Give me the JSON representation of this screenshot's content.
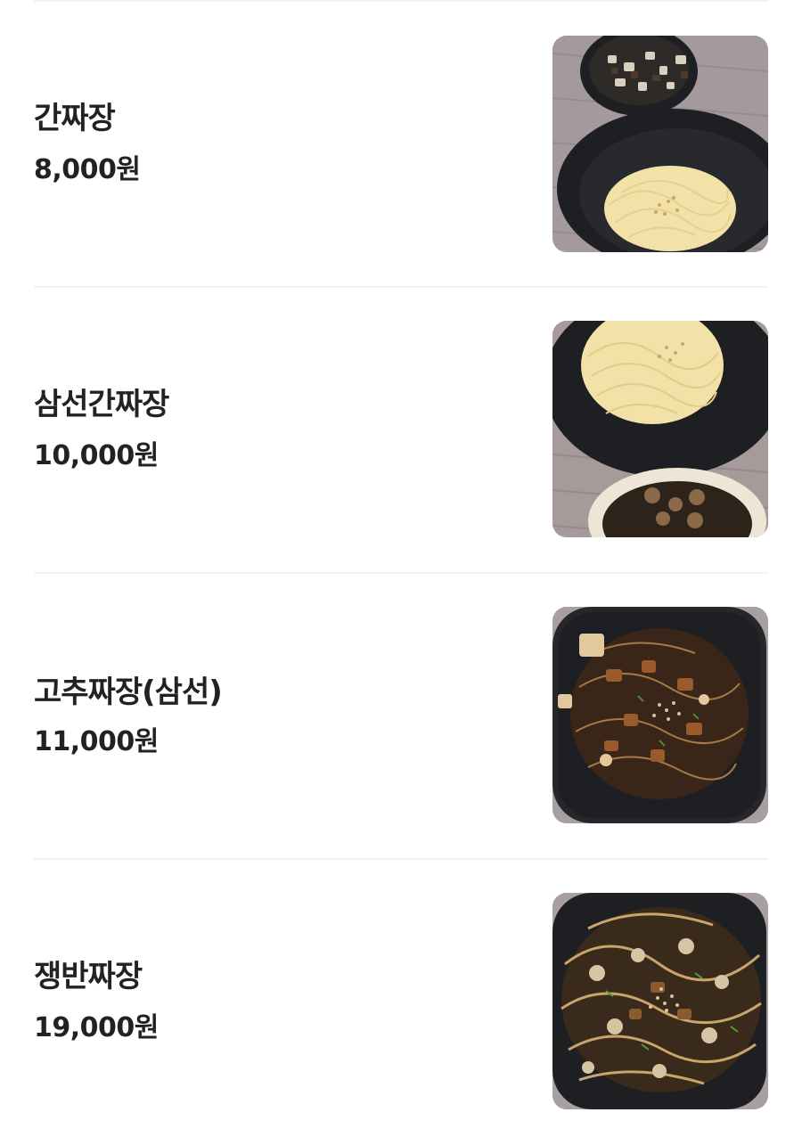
{
  "menu": {
    "items": [
      {
        "name": "간짜장",
        "price": "8,000원",
        "photo": "ganjjajang-photo"
      },
      {
        "name": "삼선간짜장",
        "price": "10,000원",
        "photo": "samseon-ganjjajang-photo"
      },
      {
        "name": "고추짜장(삼선)",
        "price": "11,000원",
        "photo": "gochu-jjajang-photo"
      },
      {
        "name": "쟁반짜장",
        "price": "19,000원",
        "photo": "jaengban-jjajang-photo"
      }
    ]
  },
  "colors": {
    "text": "#222222",
    "divider": "#f1f2f4",
    "background": "#ffffff",
    "tablecloth": "#a49a9d",
    "bowl": "#1e1f22",
    "noodle": "#f3e2a8",
    "sauce": "#3a2618"
  }
}
